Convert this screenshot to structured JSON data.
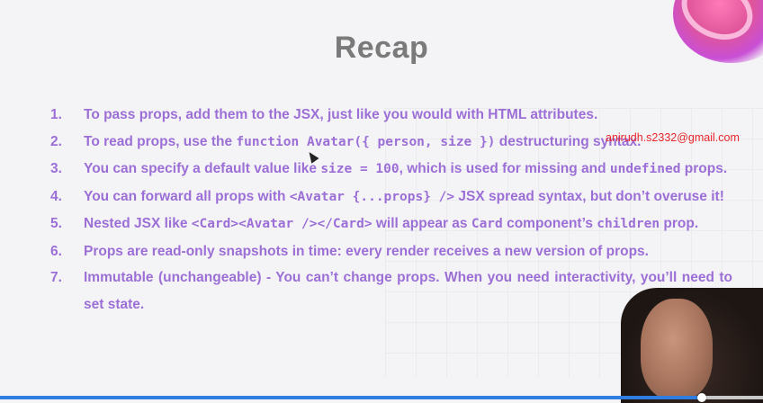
{
  "slide": {
    "title": "Recap",
    "items": [
      {
        "num": "1.",
        "segs": [
          {
            "t": "To pass props, add them to the JSX, just like you would with HTML attributes."
          }
        ]
      },
      {
        "num": "2.",
        "segs": [
          {
            "t": "To read props, use the "
          },
          {
            "t": "function Avatar({ person, size })",
            "code": true
          },
          {
            "t": " destructuring syntax."
          }
        ]
      },
      {
        "num": "3.",
        "segs": [
          {
            "t": "You can specify a default value like "
          },
          {
            "t": "size = 100",
            "code": true
          },
          {
            "t": ", which is used for missing and "
          },
          {
            "t": "undefined",
            "code": true
          },
          {
            "t": " props."
          }
        ]
      },
      {
        "num": "4.",
        "segs": [
          {
            "t": "You can forward all props with "
          },
          {
            "t": "<Avatar {...props} />",
            "code": true
          },
          {
            "t": " JSX spread syntax, but don’t overuse it!"
          }
        ]
      },
      {
        "num": "5.",
        "segs": [
          {
            "t": "Nested JSX like "
          },
          {
            "t": "<Card><Avatar /></Card>",
            "code": true
          },
          {
            "t": " will appear as "
          },
          {
            "t": "Card",
            "code": true
          },
          {
            "t": " component’s "
          },
          {
            "t": "children",
            "code": true
          },
          {
            "t": " prop."
          }
        ]
      },
      {
        "num": "6.",
        "segs": [
          {
            "t": "Props are read-only snapshots in time: every render receives a new version of props."
          }
        ]
      },
      {
        "num": "7.",
        "segs": [
          {
            "t": "Immutable (unchangeable) - You can’t change props. When you need interactivity, you’ll need to set state."
          }
        ]
      }
    ]
  },
  "overlay": {
    "email": "anirudh.s2332@gmail.com"
  },
  "video": {
    "progress": 0.92
  },
  "colors": {
    "accent": "#9c6fd6",
    "title": "#7a7a7a",
    "email": "#e8262b",
    "progress": "#2f7de1"
  }
}
